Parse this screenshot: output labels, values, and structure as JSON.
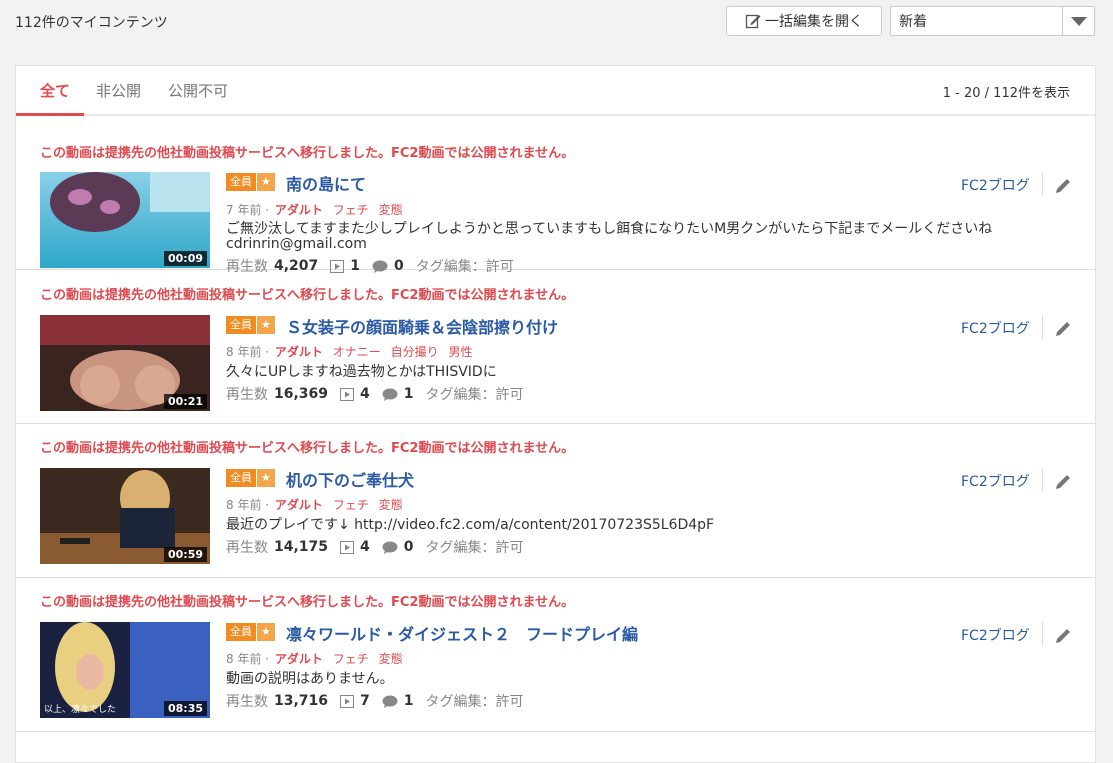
{
  "header": {
    "count_title": "112件のマイコンテンツ",
    "bulk_edit_label": "一括編集を開く",
    "sort_selected": "新着"
  },
  "tabs": [
    {
      "label": "全て",
      "active": true
    },
    {
      "label": "非公開",
      "active": false
    },
    {
      "label": "公開不可",
      "active": false
    }
  ],
  "range_text": "1 - 20 / 112件を表示",
  "badge": {
    "audience": "全員",
    "star": "★"
  },
  "stats_labels": {
    "views": "再生数",
    "tag_edit": "タグ編集：許可"
  },
  "items": [
    {
      "notice": "この動画は提携先の他社動画投稿サービスへ移行しました。FC2動画では公開されません。",
      "title": "南の島にて",
      "age": "7 年前 ·",
      "category": "アダルト",
      "tags": [
        "フェチ",
        "変態"
      ],
      "description": "ご無沙汰してますまた少しプレイしようかと思っていますもし餌食になりたいM男クンがいたら下記までメールくださいね cdrinrin@gmail.com",
      "views": "4,207",
      "clips": "1",
      "comments": "0",
      "duration": "00:09",
      "blog_label": "FC2ブログ",
      "thumb_caption": ""
    },
    {
      "notice": "この動画は提携先の他社動画投稿サービスへ移行しました。FC2動画では公開されません。",
      "title": "Ｓ女装子の顔面騎乗＆会陰部擦り付け",
      "age": "8 年前 ·",
      "category": "アダルト",
      "tags": [
        "オナニー",
        "自分撮り",
        "男性"
      ],
      "description": "久々にUPしますね過去物とかはTHISVIDに",
      "views": "16,369",
      "clips": "4",
      "comments": "1",
      "duration": "00:21",
      "blog_label": "FC2ブログ",
      "thumb_caption": ""
    },
    {
      "notice": "この動画は提携先の他社動画投稿サービスへ移行しました。FC2動画では公開されません。",
      "title": "机の下のご奉仕犬",
      "age": "8 年前 ·",
      "category": "アダルト",
      "tags": [
        "フェチ",
        "変態"
      ],
      "description": "最近のプレイです↓ http://video.fc2.com/a/content/20170723S5L6D4pF",
      "views": "14,175",
      "clips": "4",
      "comments": "0",
      "duration": "00:59",
      "blog_label": "FC2ブログ",
      "thumb_caption": ""
    },
    {
      "notice": "この動画は提携先の他社動画投稿サービスへ移行しました。FC2動画では公開されません。",
      "title": "凛々ワールド・ダイジェスト２　フードプレイ編",
      "age": "8 年前 ·",
      "category": "アダルト",
      "tags": [
        "フェチ",
        "変態"
      ],
      "description": "動画の説明はありません。",
      "views": "13,716",
      "clips": "7",
      "comments": "1",
      "duration": "08:35",
      "blog_label": "FC2ブログ",
      "thumb_caption": "以上、凛々でした"
    }
  ],
  "colors": {
    "accent_red": "#e0494f",
    "link_blue": "#2a5aa4",
    "badge_orange": "#f08c21"
  }
}
